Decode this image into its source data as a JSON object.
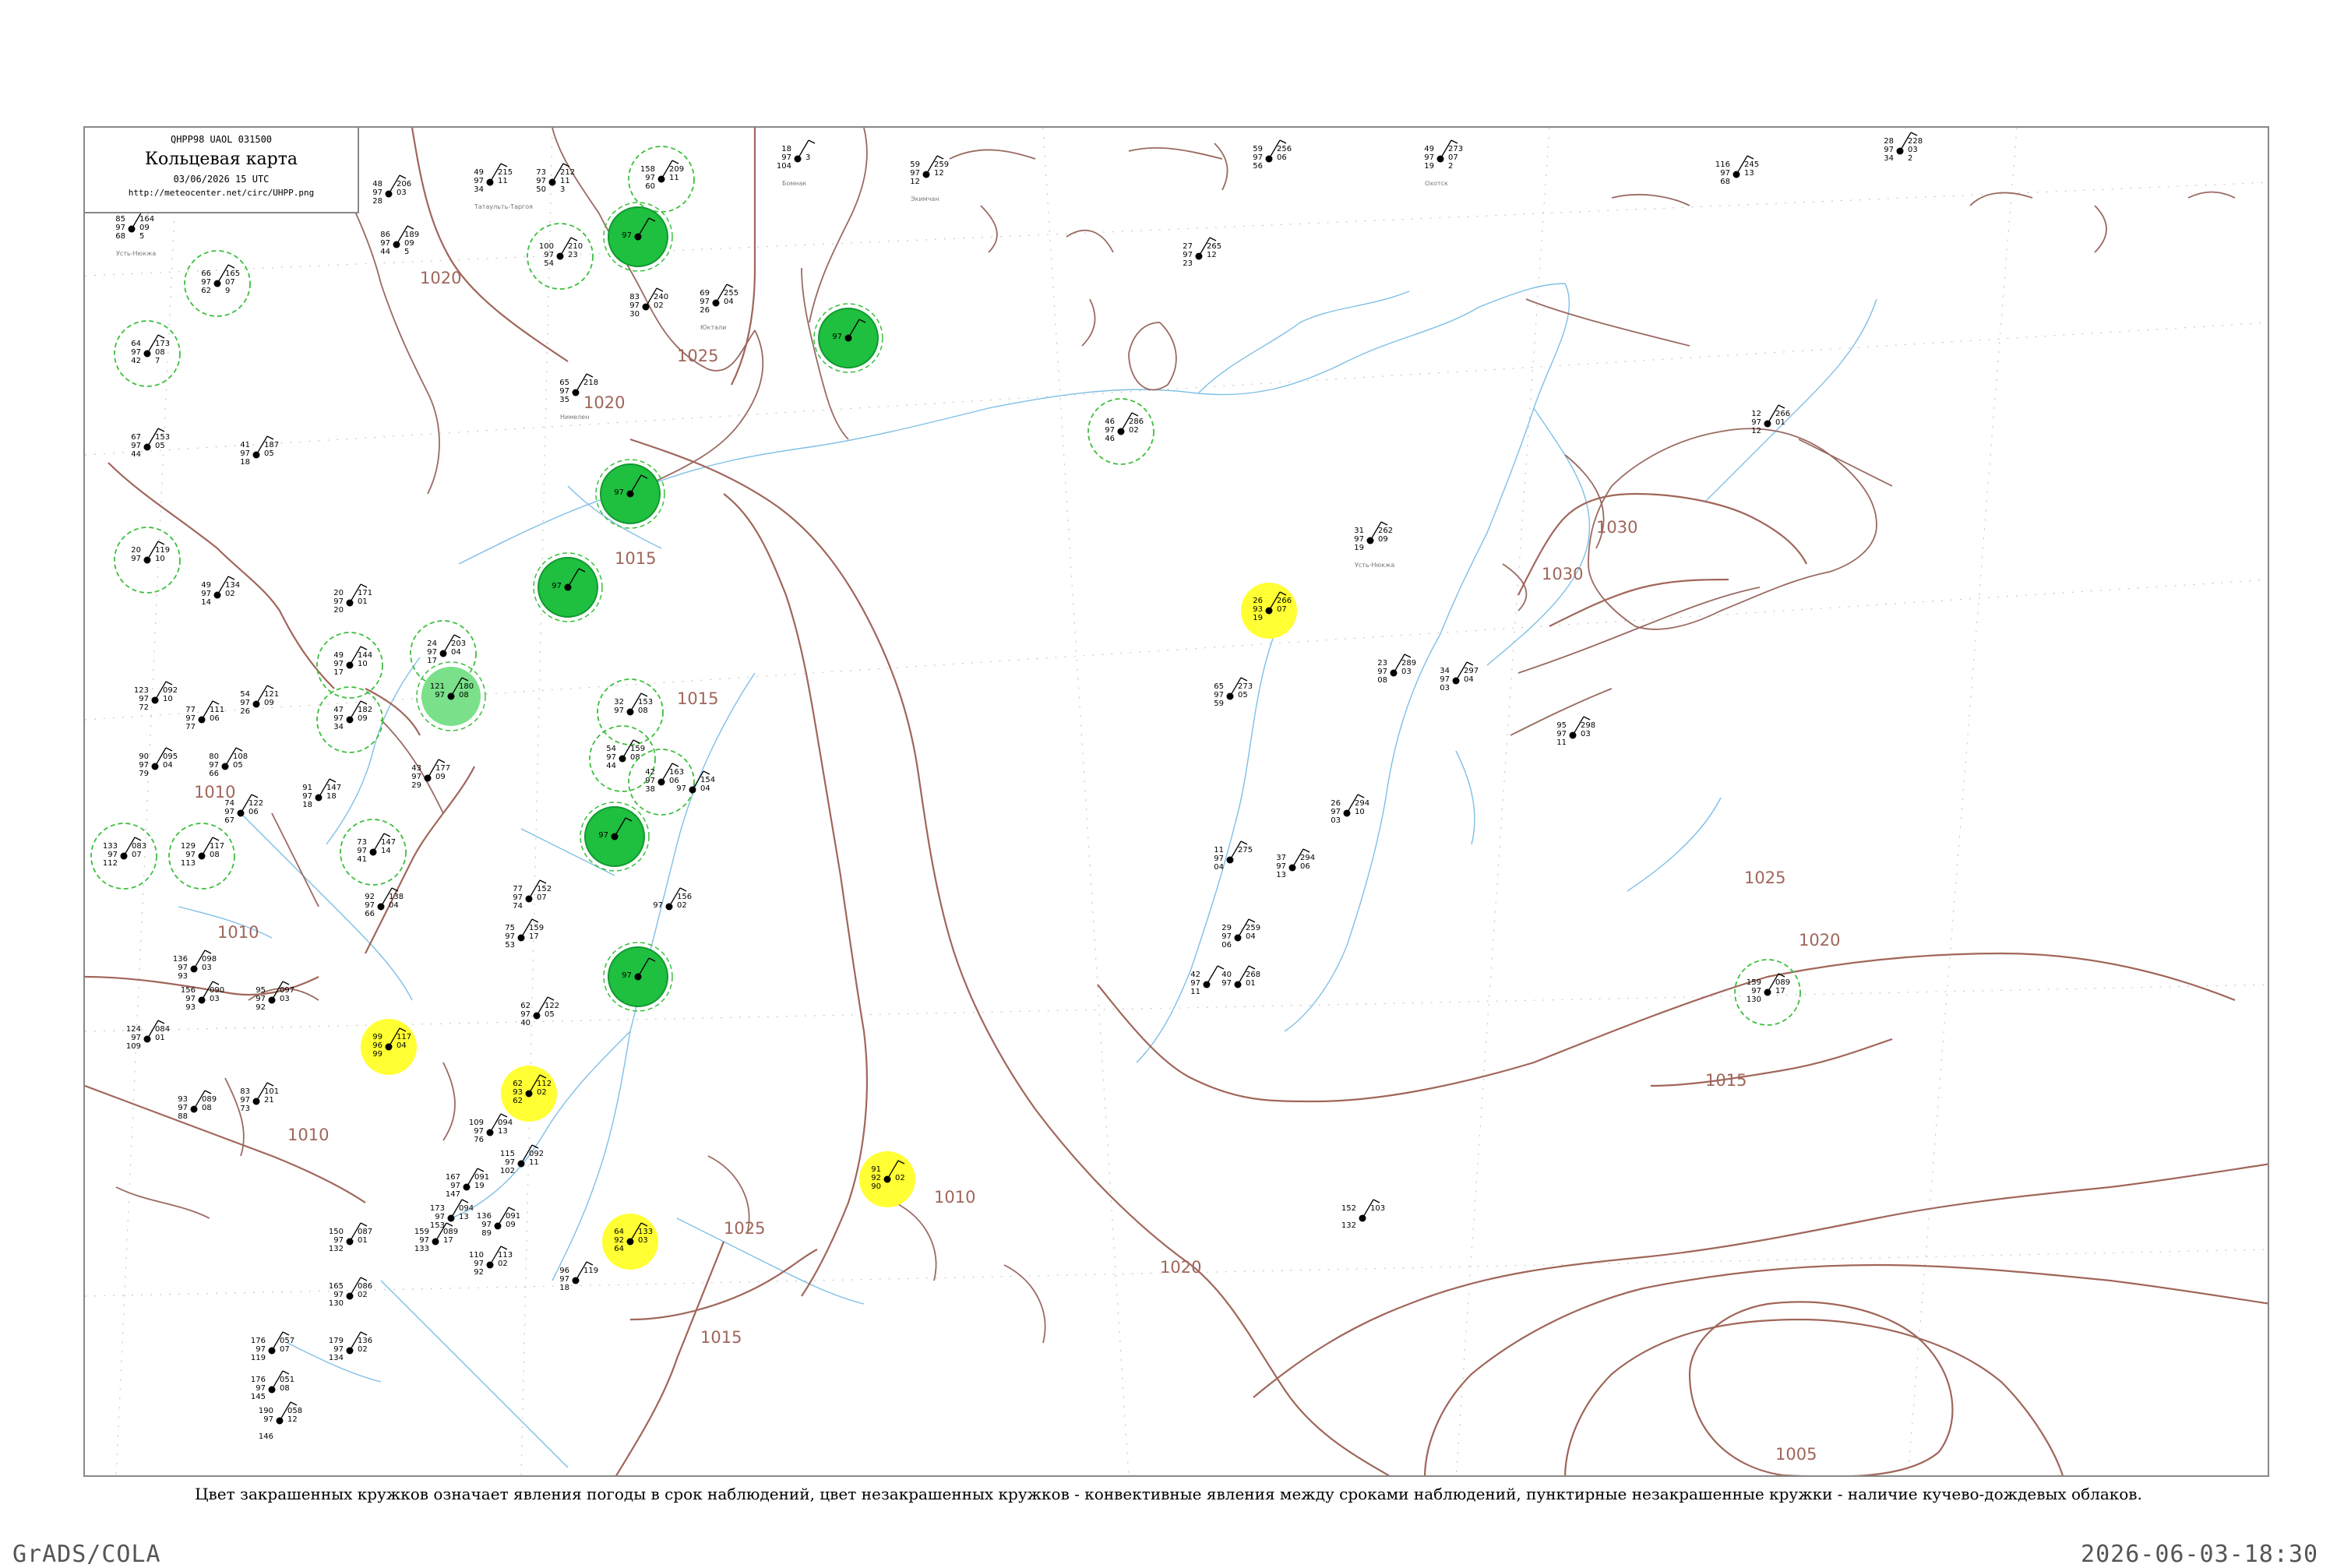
{
  "header": {
    "code": "QHPP98  UAOL  031500",
    "title": "Кольцевая карта",
    "datetime": "03/06/2026 15 UTC",
    "url": "http://meteocenter.net/circ/UHPP.png"
  },
  "caption": "Цвет закрашенных кружков означает явления погоды в срок наблюдений, цвет незакрашенных кружков - конвективные явления между сроками наблюдений, пунктирные незакрашенные кружки - наличие кучево-дождевых облаков.",
  "footer": {
    "left": "GrADS/COLA",
    "right": "2026-06-03-18:30"
  },
  "colors": {
    "isobar": "#a0665a",
    "river": "#7fbfe6",
    "thunder_fill": "#1fbf3f",
    "rain_shower_fill": "#7be08a",
    "fog_fill": "#ffff33",
    "cb_ring": "#3cbf3c"
  },
  "isobar_labels": [
    "1020",
    "1025",
    "1020",
    "1015",
    "1010",
    "1010",
    "1010",
    "1015",
    "1015",
    "1025",
    "1030",
    "1030",
    "1025",
    "1020",
    "1015",
    "1010",
    "1020",
    "1005"
  ],
  "stations": [
    {
      "name": "Усть-Нюкжа",
      "left": [
        "85",
        "97",
        "68"
      ],
      "right": [
        "164",
        "09",
        "5"
      ],
      "kind": "plain"
    },
    {
      "name": "",
      "left": [
        "66",
        "97",
        "62"
      ],
      "right": [
        "165",
        "07",
        "9"
      ],
      "kind": "cb"
    },
    {
      "name": "",
      "left": [
        "64",
        "97",
        "42"
      ],
      "right": [
        "173",
        "08",
        "7"
      ],
      "kind": "cb"
    },
    {
      "name": "",
      "left": [
        "48",
        "97",
        "28"
      ],
      "right": [
        "206",
        "03"
      ],
      "kind": "plain"
    },
    {
      "name": "",
      "left": [
        "86",
        "97",
        "44"
      ],
      "right": [
        "189",
        "09",
        "5"
      ],
      "kind": "plain"
    },
    {
      "name": "Татаульть-Таргоя",
      "left": [
        "49",
        "97",
        "34"
      ],
      "right": [
        "215",
        "11"
      ],
      "kind": "plain"
    },
    {
      "name": "",
      "left": [
        "73",
        "97",
        "50"
      ],
      "right": [
        "212",
        "11",
        "3"
      ],
      "kind": "plain"
    },
    {
      "name": "",
      "left": [
        "100",
        "97",
        "54"
      ],
      "right": [
        "210",
        "23"
      ],
      "kind": "cb"
    },
    {
      "name": "",
      "left": [
        "158",
        "97",
        "60"
      ],
      "right": [
        "209",
        "11"
      ],
      "kind": "cb"
    },
    {
      "name": "",
      "left": [
        "",
        "97",
        ""
      ],
      "right": [
        "",
        "",
        ""
      ],
      "kind": "thunder"
    },
    {
      "name": "",
      "left": [
        "83",
        "97",
        "30"
      ],
      "right": [
        "240",
        "02"
      ],
      "kind": "plain"
    },
    {
      "name": "Юктали",
      "left": [
        "69",
        "97",
        "26"
      ],
      "right": [
        "255",
        "04"
      ],
      "kind": "plain"
    },
    {
      "name": "Бомнак",
      "left": [
        "18",
        "97",
        "104"
      ],
      "right": [
        "",
        "3"
      ],
      "kind": "plain"
    },
    {
      "name": "Экимчан",
      "left": [
        "59",
        "97",
        "12"
      ],
      "right": [
        "259",
        "12"
      ],
      "kind": "plain"
    },
    {
      "name": "",
      "left": [
        "59",
        "97",
        "56"
      ],
      "right": [
        "256",
        "06"
      ],
      "kind": "plain"
    },
    {
      "name": "Охотск",
      "left": [
        "49",
        "97",
        "19"
      ],
      "right": [
        "273",
        "07",
        "2"
      ],
      "kind": "plain"
    },
    {
      "name": "",
      "left": [
        "28",
        "97",
        "34"
      ],
      "right": [
        "228",
        "03",
        "2"
      ],
      "kind": "plain"
    },
    {
      "name": "",
      "left": [
        "116",
        "97",
        "68"
      ],
      "right": [
        "245",
        "13"
      ],
      "kind": "plain"
    },
    {
      "name": "",
      "left": [
        "27",
        "97",
        "23"
      ],
      "right": [
        "265",
        "12"
      ],
      "kind": "plain"
    },
    {
      "name": "",
      "left": [
        "",
        "97",
        ""
      ],
      "right": [
        "",
        "",
        ""
      ],
      "kind": "thunder"
    },
    {
      "name": "Нимелен",
      "left": [
        "65",
        "97",
        "35"
      ],
      "right": [
        "218",
        ""
      ],
      "kind": "plain"
    },
    {
      "name": "",
      "left": [
        "46",
        "97",
        "46"
      ],
      "right": [
        "286",
        "02"
      ],
      "kind": "cb"
    },
    {
      "name": "",
      "left": [
        "12",
        "97",
        "12"
      ],
      "right": [
        "266",
        "01"
      ],
      "kind": "plain"
    },
    {
      "name": "",
      "left": [
        "67",
        "97",
        "44"
      ],
      "right": [
        "153",
        "05"
      ],
      "kind": "plain"
    },
    {
      "name": "",
      "left": [
        "41",
        "97",
        "18"
      ],
      "right": [
        "187",
        "05"
      ],
      "kind": "plain"
    },
    {
      "name": "",
      "left": [
        "",
        "97",
        ""
      ],
      "right": [
        "",
        "",
        ""
      ],
      "kind": "thunder"
    },
    {
      "name": "Усть-Нюкжа",
      "left": [
        "31",
        "97",
        "19"
      ],
      "right": [
        "262",
        "09"
      ],
      "kind": "plain"
    },
    {
      "name": "",
      "left": [
        "20",
        "97",
        ""
      ],
      "right": [
        "119",
        "10"
      ],
      "kind": "cb"
    },
    {
      "name": "",
      "left": [
        "",
        "97",
        ""
      ],
      "right": [
        "",
        "",
        ""
      ],
      "kind": "thunder"
    },
    {
      "name": "",
      "left": [
        "49",
        "97",
        "14"
      ],
      "right": [
        "134",
        "02"
      ],
      "kind": "plain"
    },
    {
      "name": "",
      "left": [
        "20",
        "97",
        "20"
      ],
      "right": [
        "171",
        "01"
      ],
      "kind": "plain"
    },
    {
      "name": "",
      "left": [
        "26",
        "93",
        "19"
      ],
      "right": [
        "266",
        "07"
      ],
      "kind": "fog"
    },
    {
      "name": "",
      "left": [
        "23",
        "97",
        "08"
      ],
      "right": [
        "289",
        "03"
      ],
      "kind": "plain"
    },
    {
      "name": "",
      "left": [
        "34",
        "97",
        "03"
      ],
      "right": [
        "297",
        "04"
      ],
      "kind": "plain"
    },
    {
      "name": "",
      "left": [
        "49",
        "97",
        "17"
      ],
      "right": [
        "144",
        "10"
      ],
      "kind": "cb"
    },
    {
      "name": "",
      "left": [
        "24",
        "97",
        "17"
      ],
      "right": [
        "203",
        "04"
      ],
      "kind": "cb"
    },
    {
      "name": "",
      "left": [
        "121",
        "97",
        ""
      ],
      "right": [
        "180",
        "08"
      ],
      "kind": "shower"
    },
    {
      "name": "",
      "left": [
        "65",
        "97",
        "59"
      ],
      "right": [
        "273",
        "05"
      ],
      "kind": "plain"
    },
    {
      "name": "",
      "left": [
        "95",
        "97",
        "11"
      ],
      "right": [
        "298",
        "03"
      ],
      "kind": "plain"
    },
    {
      "name": "",
      "left": [
        "123",
        "97",
        "72"
      ],
      "right": [
        "092",
        "10"
      ],
      "kind": "plain"
    },
    {
      "name": "",
      "left": [
        "54",
        "97",
        "26"
      ],
      "right": [
        "121",
        "09"
      ],
      "kind": "plain"
    },
    {
      "name": "",
      "left": [
        "77",
        "97",
        "77"
      ],
      "right": [
        "111",
        "06"
      ],
      "kind": "plain"
    },
    {
      "name": "",
      "left": [
        "90",
        "97",
        "79"
      ],
      "right": [
        "095",
        "04"
      ],
      "kind": "plain"
    },
    {
      "name": "",
      "left": [
        "80",
        "97",
        "66"
      ],
      "right": [
        "108",
        "05"
      ],
      "kind": "plain"
    },
    {
      "name": "",
      "left": [
        "47",
        "97",
        "34"
      ],
      "right": [
        "182",
        "09"
      ],
      "kind": "cb"
    },
    {
      "name": "",
      "left": [
        "32",
        "97",
        ""
      ],
      "right": [
        "153",
        "08"
      ],
      "kind": "cb"
    },
    {
      "name": "",
      "left": [
        "54",
        "97",
        "44"
      ],
      "right": [
        "159",
        "08"
      ],
      "kind": "cb"
    },
    {
      "name": "",
      "left": [
        "42",
        "97",
        "38"
      ],
      "right": [
        "163",
        "06"
      ],
      "kind": "cb"
    },
    {
      "name": "",
      "left": [
        "43",
        "97",
        "29"
      ],
      "right": [
        "177",
        "09"
      ],
      "kind": "plain"
    },
    {
      "name": "",
      "left": [
        "26",
        "97",
        "03"
      ],
      "right": [
        "294",
        "10"
      ],
      "kind": "plain"
    },
    {
      "name": "",
      "left": [
        "",
        "97",
        ""
      ],
      "right": [
        "",
        "",
        ""
      ],
      "kind": "thunder"
    },
    {
      "name": "",
      "left": [
        "",
        "97",
        ""
      ],
      "right": [
        "154",
        "04"
      ],
      "kind": "plain"
    },
    {
      "name": "",
      "left": [
        "91",
        "97",
        "18"
      ],
      "right": [
        "147",
        "18"
      ],
      "kind": "plain"
    },
    {
      "name": "",
      "left": [
        "74",
        "97",
        "67"
      ],
      "right": [
        "122",
        "06"
      ],
      "kind": "plain"
    },
    {
      "name": "",
      "left": [
        "73",
        "97",
        "41"
      ],
      "right": [
        "147",
        "14"
      ],
      "kind": "cb"
    },
    {
      "name": "",
      "left": [
        "133",
        "97",
        "112"
      ],
      "right": [
        "083",
        "07"
      ],
      "kind": "cb"
    },
    {
      "name": "",
      "left": [
        "129",
        "97",
        "113"
      ],
      "right": [
        "117",
        "08"
      ],
      "kind": "cb"
    },
    {
      "name": "",
      "left": [
        "11",
        "97",
        "04"
      ],
      "right": [
        "275",
        ""
      ],
      "kind": "plain"
    },
    {
      "name": "",
      "left": [
        "37",
        "97",
        "13"
      ],
      "right": [
        "294",
        "06"
      ],
      "kind": "plain"
    },
    {
      "name": "",
      "left": [
        "77",
        "97",
        "74"
      ],
      "right": [
        "152",
        "07"
      ],
      "kind": "plain"
    },
    {
      "name": "",
      "left": [
        "92",
        "97",
        "66"
      ],
      "right": [
        "138",
        "04"
      ],
      "kind": "plain"
    },
    {
      "name": "",
      "left": [
        "75",
        "97",
        "53"
      ],
      "right": [
        "159",
        "17"
      ],
      "kind": "plain"
    },
    {
      "name": "",
      "left": [
        "",
        "97",
        ""
      ],
      "right": [
        "156",
        "02"
      ],
      "kind": "plain"
    },
    {
      "name": "",
      "left": [
        "29",
        "97",
        "06"
      ],
      "right": [
        "259",
        "04"
      ],
      "kind": "plain"
    },
    {
      "name": "",
      "left": [
        "42",
        "97",
        "11"
      ],
      "right": [
        "",
        "",
        ""
      ],
      "kind": "plain"
    },
    {
      "name": "",
      "left": [
        "40",
        "97",
        ""
      ],
      "right": [
        "268",
        "01"
      ],
      "kind": "plain"
    },
    {
      "name": "",
      "left": [
        "136",
        "97",
        "93"
      ],
      "right": [
        "098",
        "03"
      ],
      "kind": "plain"
    },
    {
      "name": "",
      "left": [
        "156",
        "97",
        "93"
      ],
      "right": [
        "090",
        "03"
      ],
      "kind": "plain"
    },
    {
      "name": "",
      "left": [
        "95",
        "97",
        "92"
      ],
      "right": [
        "097",
        "03"
      ],
      "kind": "plain"
    },
    {
      "name": "",
      "left": [
        "",
        "97",
        ""
      ],
      "right": [
        "",
        "",
        ""
      ],
      "kind": "thunder"
    },
    {
      "name": "",
      "left": [
        "62",
        "97",
        "40"
      ],
      "right": [
        "122",
        "05"
      ],
      "kind": "plain"
    },
    {
      "name": "",
      "left": [
        "124",
        "97",
        "109"
      ],
      "right": [
        "084",
        "01"
      ],
      "kind": "plain"
    },
    {
      "name": "",
      "left": [
        "99",
        "96",
        "99"
      ],
      "right": [
        "117",
        "04"
      ],
      "kind": "fog"
    },
    {
      "name": "",
      "left": [
        "62",
        "93",
        "62"
      ],
      "right": [
        "112",
        "02"
      ],
      "kind": "fog"
    },
    {
      "name": "",
      "left": [
        "159",
        "97",
        "130"
      ],
      "right": [
        "089",
        "17"
      ],
      "kind": "cb"
    },
    {
      "name": "",
      "left": [
        "93",
        "97",
        "88"
      ],
      "right": [
        "089",
        "08"
      ],
      "kind": "plain"
    },
    {
      "name": "",
      "left": [
        "83",
        "97",
        "73"
      ],
      "right": [
        "101",
        "21"
      ],
      "kind": "plain"
    },
    {
      "name": "",
      "left": [
        "109",
        "97",
        "76"
      ],
      "right": [
        "094",
        "13"
      ],
      "kind": "plain"
    },
    {
      "name": "",
      "left": [
        "115",
        "97",
        "102"
      ],
      "right": [
        "092",
        "11"
      ],
      "kind": "plain"
    },
    {
      "name": "",
      "left": [
        "91",
        "92",
        "90"
      ],
      "right": [
        "",
        "02"
      ],
      "kind": "fog"
    },
    {
      "name": "",
      "left": [
        "167",
        "97",
        "147"
      ],
      "right": [
        "091",
        "19"
      ],
      "kind": "plain"
    },
    {
      "name": "",
      "left": [
        "173",
        "97",
        "153"
      ],
      "right": [
        "094",
        "13"
      ],
      "kind": "plain"
    },
    {
      "name": "",
      "left": [
        "136",
        "97",
        "89"
      ],
      "right": [
        "091",
        "09"
      ],
      "kind": "plain"
    },
    {
      "name": "",
      "left": [
        "64",
        "92",
        "64"
      ],
      "right": [
        "133",
        "03"
      ],
      "kind": "fog"
    },
    {
      "name": "",
      "left": [
        "150",
        "97",
        "132"
      ],
      "right": [
        "087",
        "01"
      ],
      "kind": "plain"
    },
    {
      "name": "",
      "left": [
        "159",
        "97",
        "133"
      ],
      "right": [
        "089",
        "17"
      ],
      "kind": "plain"
    },
    {
      "name": "",
      "left": [
        "110",
        "97",
        "92"
      ],
      "right": [
        "113",
        "02"
      ],
      "kind": "plain"
    },
    {
      "name": "",
      "left": [
        "165",
        "97",
        "130"
      ],
      "right": [
        "086",
        "02"
      ],
      "kind": "plain"
    },
    {
      "name": "",
      "left": [
        "96",
        "97",
        "18"
      ],
      "right": [
        "119",
        ""
      ],
      "kind": "plain"
    },
    {
      "name": "",
      "left": [
        "152",
        "",
        "132"
      ],
      "right": [
        "103",
        ""
      ],
      "kind": "plain"
    },
    {
      "name": "",
      "left": [
        "176",
        "97",
        "119"
      ],
      "right": [
        "057",
        "07"
      ],
      "kind": "plain"
    },
    {
      "name": "",
      "left": [
        "179",
        "97",
        "134"
      ],
      "right": [
        "136",
        "02"
      ],
      "kind": "plain"
    },
    {
      "name": "",
      "left": [
        "176",
        "97",
        "145"
      ],
      "right": [
        "051",
        "08"
      ],
      "kind": "plain"
    },
    {
      "name": "",
      "left": [
        "190",
        "97",
        "",
        "146"
      ],
      "right": [
        "058",
        "12"
      ],
      "kind": "plain"
    }
  ]
}
